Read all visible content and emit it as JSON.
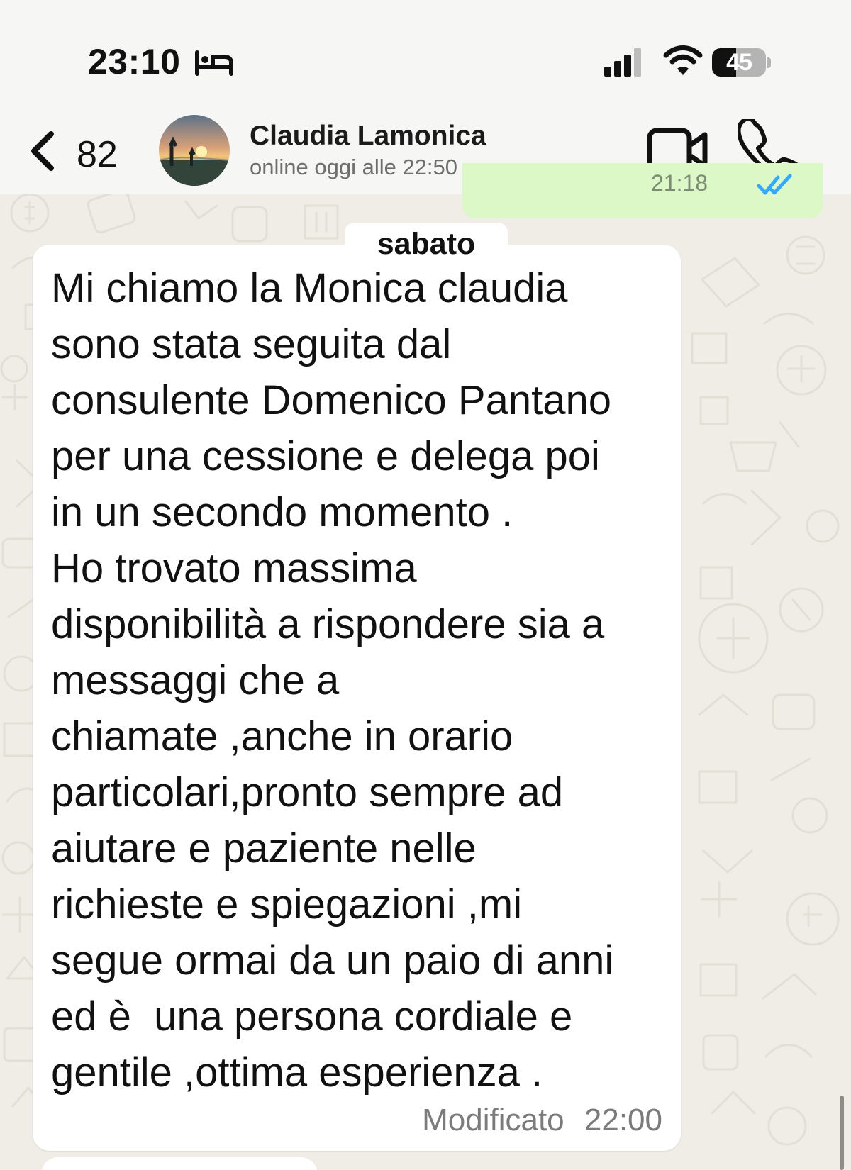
{
  "status_bar": {
    "time": "23:10",
    "focus_icon": "bed-icon",
    "signal_icon": "cellular-signal-icon",
    "wifi_icon": "wifi-icon",
    "battery_level": "45",
    "battery_fraction": 0.45
  },
  "header": {
    "back_icon": "chevron-left-icon",
    "back_count": "82",
    "contact_name": "Claudia Lamonica",
    "contact_status": "online oggi alle 22:50",
    "video_icon": "video-camera-icon",
    "call_icon": "phone-icon"
  },
  "previous_message": {
    "time": "21:18",
    "read_icon": "double-check-icon"
  },
  "date_separator": "sabato",
  "message": {
    "lines": [
      "Mi chiamo la Monica claudia",
      "sono stata seguita dal",
      "consulente Domenico Pantano",
      "per una cessione e delega poi",
      "in un secondo momento .",
      "Ho trovato massima",
      "disponibilità a rispondere sia a",
      "messaggi che a",
      "chiamate ,anche in orario",
      "particolari,pronto sempre ad",
      "aiutare e paziente nelle",
      "richieste e spiegazioni ,mi",
      "segue ormai da un paio di anni",
      "ed è  una persona cordiale e",
      "gentile ,ottima esperienza ."
    ],
    "edited_label": "Modificato",
    "time": "22:00"
  },
  "colors": {
    "wallpaper": "#efede5",
    "outgoing_bubble": "#dcf8c6",
    "incoming_bubble": "#ffffff",
    "read_receipt": "#35a8ff"
  }
}
